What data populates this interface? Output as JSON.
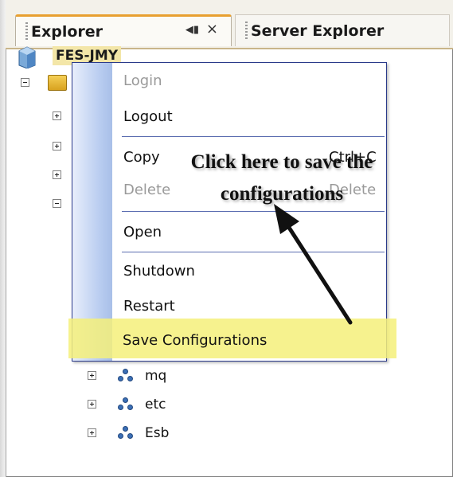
{
  "tabs": {
    "explorer": "Explorer",
    "pin_glyph": "◀▮",
    "close_glyph": "×",
    "server_explorer": "Server Explorer"
  },
  "tree": {
    "root_label": "FES-JMY",
    "children": [
      {
        "label": "mq"
      },
      {
        "label": "etc"
      },
      {
        "label": "Esb"
      }
    ]
  },
  "context_menu": {
    "items": {
      "login": "Login",
      "logout": "Logout",
      "copy": "Copy",
      "copy_shortcut": "Ctrl+C",
      "delete": "Delete",
      "delete_shortcut": "Delete",
      "open": "Open",
      "shutdown": "Shutdown",
      "restart": "Restart",
      "save_configurations": "Save Configurations"
    }
  },
  "annotation": {
    "line1": "Click here to save the",
    "line2": "configurations"
  },
  "colors": {
    "highlight": "#f5f07a",
    "menu_border": "#2a3a8a",
    "active_tab_accent": "#e8a030"
  }
}
